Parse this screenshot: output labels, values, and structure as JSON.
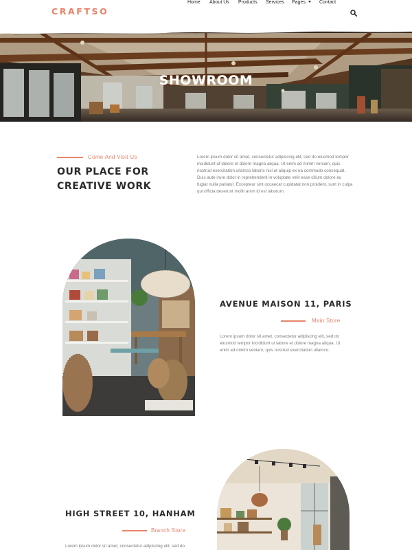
{
  "brand": {
    "logo_text": "CRAFTSO",
    "accent_color": "#e8836a"
  },
  "nav": {
    "items": [
      {
        "label": "Home"
      },
      {
        "label": "About Us"
      },
      {
        "label": "Products"
      },
      {
        "label": "Services"
      },
      {
        "label": "Pages"
      },
      {
        "label": "Contact"
      }
    ],
    "search_icon": "search-icon",
    "pages_icon": "chevron-down-icon"
  },
  "hero": {
    "title": "SHOWROOM"
  },
  "intro": {
    "eyebrow": "Come And Visit Us",
    "heading_line1": "OUR PLACE FOR",
    "heading_line2": "CREATIVE WORK",
    "paragraph_lines": [
      "Lorem ipsum dolor sit amet, consectetur adipiscing elit, sed do eiusmod tempor",
      "incididunt ut labore et dolore magna aliqua. Ut enim ad minim veniam, quis",
      "nostrud exercitation ullamco laboris nisi ut aliquip ex ea commodo consequat.",
      "Duis aute irure dolor in reprehenderit in voluptate velit esse cillum dolore eu",
      "fugiat nulla pariatur. Excepteur sint occaecat cupidatat non proident, sunt in culpa",
      "qui officia deserunt mollit anim id est laborum."
    ]
  },
  "stores": [
    {
      "title": "AVENUE MAISON 11, PARIS",
      "label": "Main Store",
      "paragraph_lines": [
        "Lorem ipsum dolor sit amet, consectetur adipiscing elit, sed do",
        "eiusmod tempor incididunt ut labore et dolore magna aliqua. Ut",
        "enim ad minim veniam, quis nostrud exercitation ullamco."
      ]
    },
    {
      "title": "HIGH STREET 10, HANHAM",
      "label": "Branch Store",
      "paragraph_lines": [
        "Lorem ipsum dolor sit amet, consectetur adipiscing elit, sed do"
      ]
    }
  ]
}
